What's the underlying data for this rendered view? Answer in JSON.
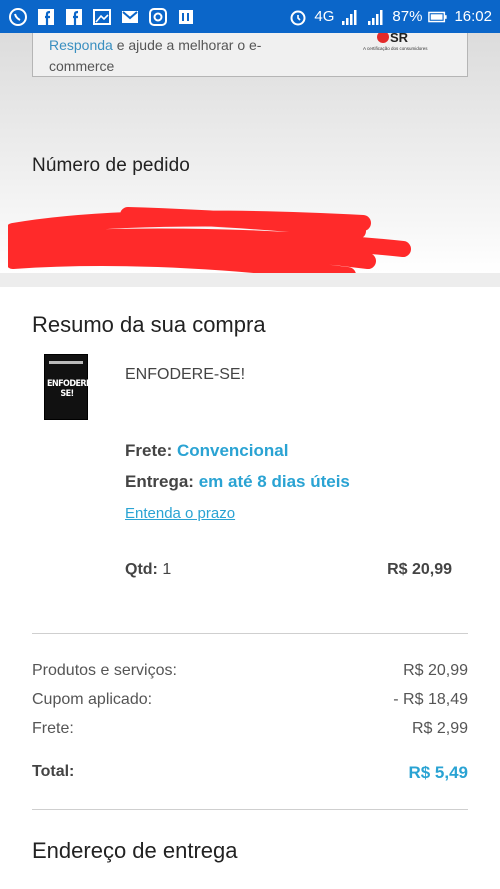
{
  "status_bar": {
    "network": "4G",
    "battery": "87%",
    "time": "16:02"
  },
  "feedback": {
    "link": "Responda",
    "rest": " e ajude a melhorar o e-commerce"
  },
  "order": {
    "title": "Número de pedido"
  },
  "summary": {
    "title": "Resumo da sua compra",
    "product_name": "ENFODERE-SE!",
    "thumb_title": "ENFODERE-SE!",
    "frete_label": "Frete:",
    "frete_value": "Convencional",
    "entrega_label": "Entrega:",
    "entrega_value": "em até 8 dias úteis",
    "prazo_link": "Entenda o prazo",
    "qtd_label": "Qtd:",
    "qtd_value": "1",
    "item_price": "R$ 20,99"
  },
  "totals": {
    "products_label": "Produtos e serviços:",
    "products_value": "R$ 20,99",
    "coupon_label": "Cupom aplicado:",
    "coupon_value": "- R$ 18,49",
    "shipping_label": "Frete:",
    "shipping_value": "R$ 2,99",
    "total_label": "Total:",
    "total_value": "R$ 5,49"
  },
  "address": {
    "title": "Endereço de entrega"
  },
  "colors": {
    "status_bar": "#0b66c9",
    "accent_blue": "#2aa3d3",
    "redaction": "#ff2a2a"
  }
}
